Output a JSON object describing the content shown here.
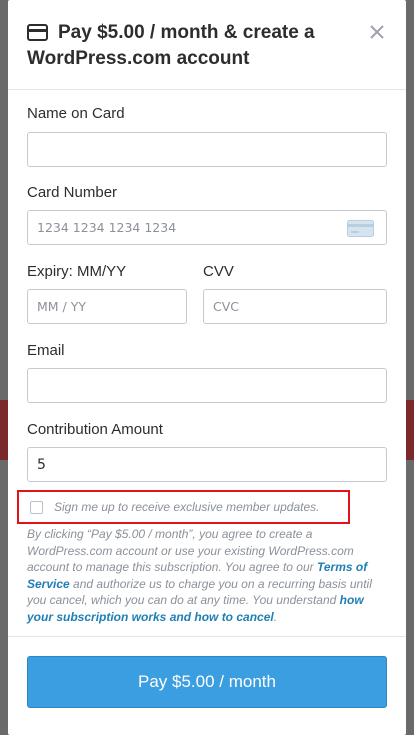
{
  "modal": {
    "title": "Pay $5.00 / month & create a WordPress.com account",
    "icons": {
      "card": "credit-card-icon",
      "close": "close-icon",
      "card_number": "credit-card-icon"
    }
  },
  "form": {
    "name_label": "Name on Card",
    "name_value": "",
    "card_number_label": "Card Number",
    "card_number_placeholder": "1234 1234 1234 1234",
    "expiry_label": "Expiry: MM/YY",
    "expiry_placeholder": "MM / YY",
    "cvv_label": "CVV",
    "cvv_placeholder": "CVC",
    "email_label": "Email",
    "email_value": "",
    "contribution_label": "Contribution Amount",
    "contribution_value": "5"
  },
  "signup": {
    "checkbox_label": "Sign me up to receive exclusive member updates.",
    "checked": false
  },
  "terms": {
    "part1": "By clicking “Pay $5.00 / month”, you agree to create a WordPress.com account or use your existing WordPress.com account to manage this subscription. You agree to our ",
    "terms_link": "Terms of Service",
    "part2": " and authorize us to charge you on a recurring basis until you cancel, which you can do at any time. You understand ",
    "how_link": "how your subscription works and how to cancel",
    "part3": "."
  },
  "pay_button": {
    "label": "Pay $5.00 / month"
  },
  "colors": {
    "accent": "#3b9ee0",
    "highlight": "#e0131b",
    "link": "#1f7fb5"
  }
}
